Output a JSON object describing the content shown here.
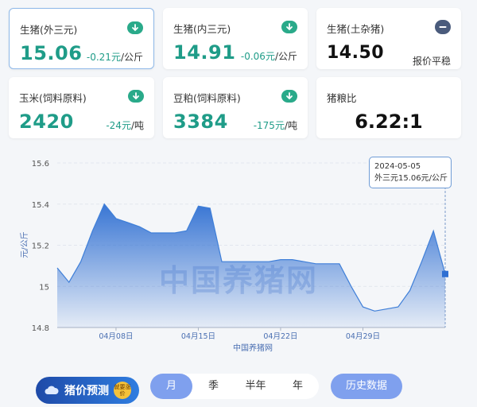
{
  "cards": [
    {
      "name": "生猪(外三元)",
      "price": "15.06",
      "change": "-0.21元",
      "unit": "/公斤",
      "trend": "down",
      "icon": "down-arrow-icon"
    },
    {
      "name": "生猪(内三元)",
      "price": "14.91",
      "change": "-0.06元",
      "unit": "/公斤",
      "trend": "down",
      "icon": "down-arrow-icon"
    },
    {
      "name": "生猪(土杂猪)",
      "price": "14.50",
      "flat_text": "报价平稳",
      "trend": "flat",
      "icon": "minus-icon"
    },
    {
      "name": "玉米(饲料原料)",
      "price": "2420",
      "change": "-24元",
      "unit": "/吨",
      "trend": "down",
      "icon": "down-arrow-icon"
    },
    {
      "name": "豆粕(饲料原料)",
      "price": "3384",
      "change": "-175元",
      "unit": "/吨",
      "trend": "down",
      "icon": "down-arrow-icon"
    },
    {
      "name": "猪粮比",
      "price": "6.22:1"
    }
  ],
  "colors": {
    "up_down_green": "#1f9c88",
    "chart_line": "#3f7fd8",
    "tab_active": "#7fa0ee"
  },
  "watermark": "中国养猪网",
  "tooltip": {
    "date": "2024-05-05",
    "text": "外三元15.06元/公斤"
  },
  "chart_data": {
    "type": "area",
    "ylabel": "元/公斤",
    "xlabel": "中国养猪网",
    "ylim": [
      14.8,
      15.6
    ],
    "yticks": [
      "15.6",
      "15.4",
      "15.2",
      "15",
      "14.8"
    ],
    "xticks": [
      "04月08日",
      "04月15日",
      "04月22日",
      "04月29日"
    ],
    "x": [
      "04-03",
      "04-04",
      "04-05",
      "04-06",
      "04-07",
      "04-08",
      "04-09",
      "04-10",
      "04-11",
      "04-12",
      "04-13",
      "04-14",
      "04-15",
      "04-16",
      "04-17",
      "04-18",
      "04-19",
      "04-20",
      "04-21",
      "04-22",
      "04-23",
      "04-24",
      "04-25",
      "04-26",
      "04-27",
      "04-28",
      "04-29",
      "04-30",
      "05-01",
      "05-02",
      "05-03",
      "05-04",
      "05-05"
    ],
    "values": [
      15.09,
      15.02,
      15.12,
      15.27,
      15.4,
      15.33,
      15.31,
      15.29,
      15.26,
      15.26,
      15.26,
      15.27,
      15.39,
      15.38,
      15.12,
      15.12,
      15.12,
      15.12,
      15.12,
      15.13,
      15.13,
      15.12,
      15.11,
      15.11,
      15.11,
      15.0,
      14.9,
      14.88,
      14.89,
      14.9,
      14.98,
      15.12,
      15.27,
      15.06
    ],
    "grid": true
  },
  "footer": {
    "predict_label": "猪价预测",
    "predict_badge": "就要涨价",
    "tabs": [
      "月",
      "季",
      "半年",
      "年"
    ],
    "active_tab": "月",
    "history_label": "历史数据"
  }
}
